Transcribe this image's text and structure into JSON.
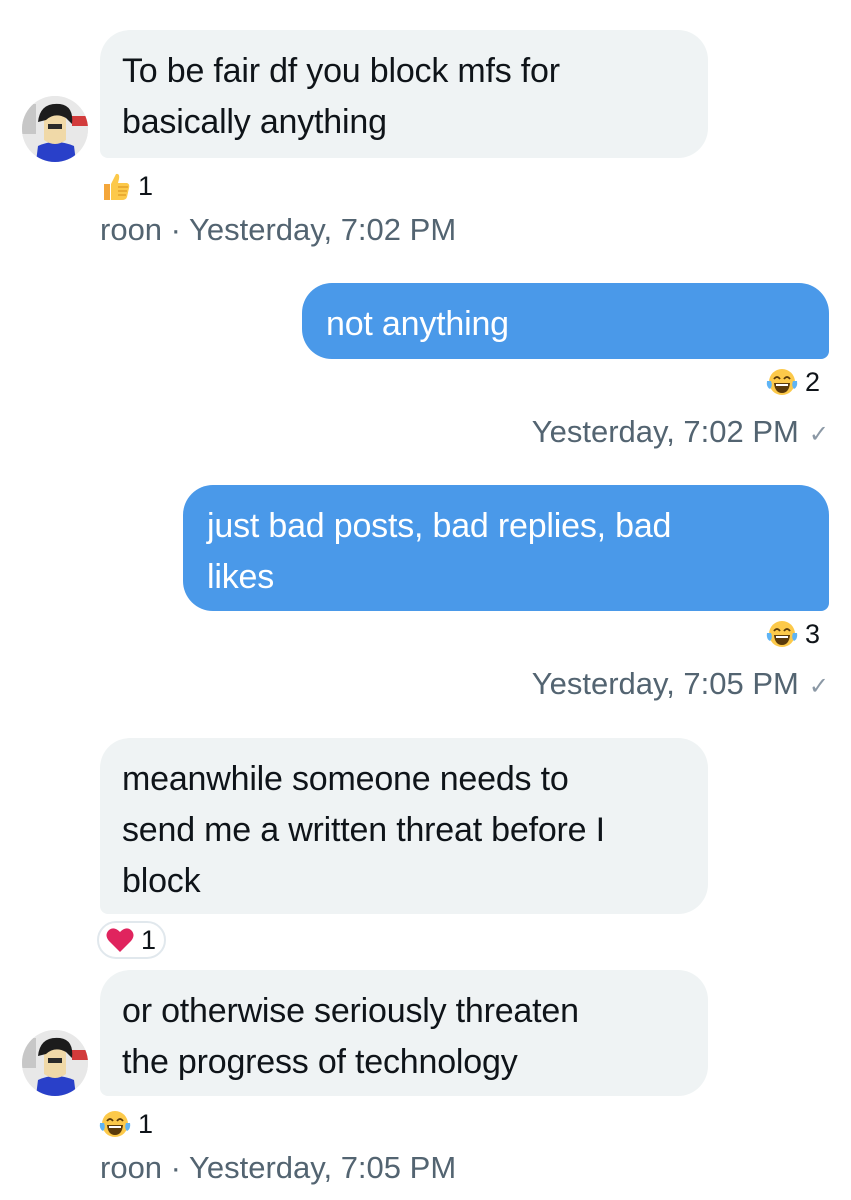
{
  "conversation": {
    "messages": [
      {
        "sender": "roon",
        "text": "To be fair df you block mfs for\nbasically anything",
        "reaction": {
          "icon": "thumbs-up-icon",
          "count": "1"
        },
        "meta": "roon · Yesterday, 7:02 PM"
      },
      {
        "sender": "me",
        "text": "not anything",
        "reaction": {
          "icon": "laughing-crying-icon",
          "count": "2"
        },
        "meta": "Yesterday, 7:02 PM"
      },
      {
        "sender": "me",
        "text": "just bad posts, bad replies, bad\nlikes",
        "reaction": {
          "icon": "laughing-crying-icon",
          "count": "3"
        },
        "meta": "Yesterday, 7:05 PM"
      },
      {
        "sender": "roon",
        "text": "meanwhile someone needs to\nsend me a written threat before I\nblock",
        "reaction": {
          "icon": "heart-icon",
          "count": "1"
        }
      },
      {
        "sender": "roon",
        "text": "or otherwise seriously threaten\nthe progress of technology",
        "reaction": {
          "icon": "laughing-crying-icon",
          "count": "1"
        },
        "meta": "roon · Yesterday, 7:05 PM"
      }
    ]
  },
  "colors": {
    "incoming_bubble": "#eff3f4",
    "outgoing_bubble": "#4a99e9",
    "meta_text": "#536471",
    "heart": "#e0245e"
  }
}
